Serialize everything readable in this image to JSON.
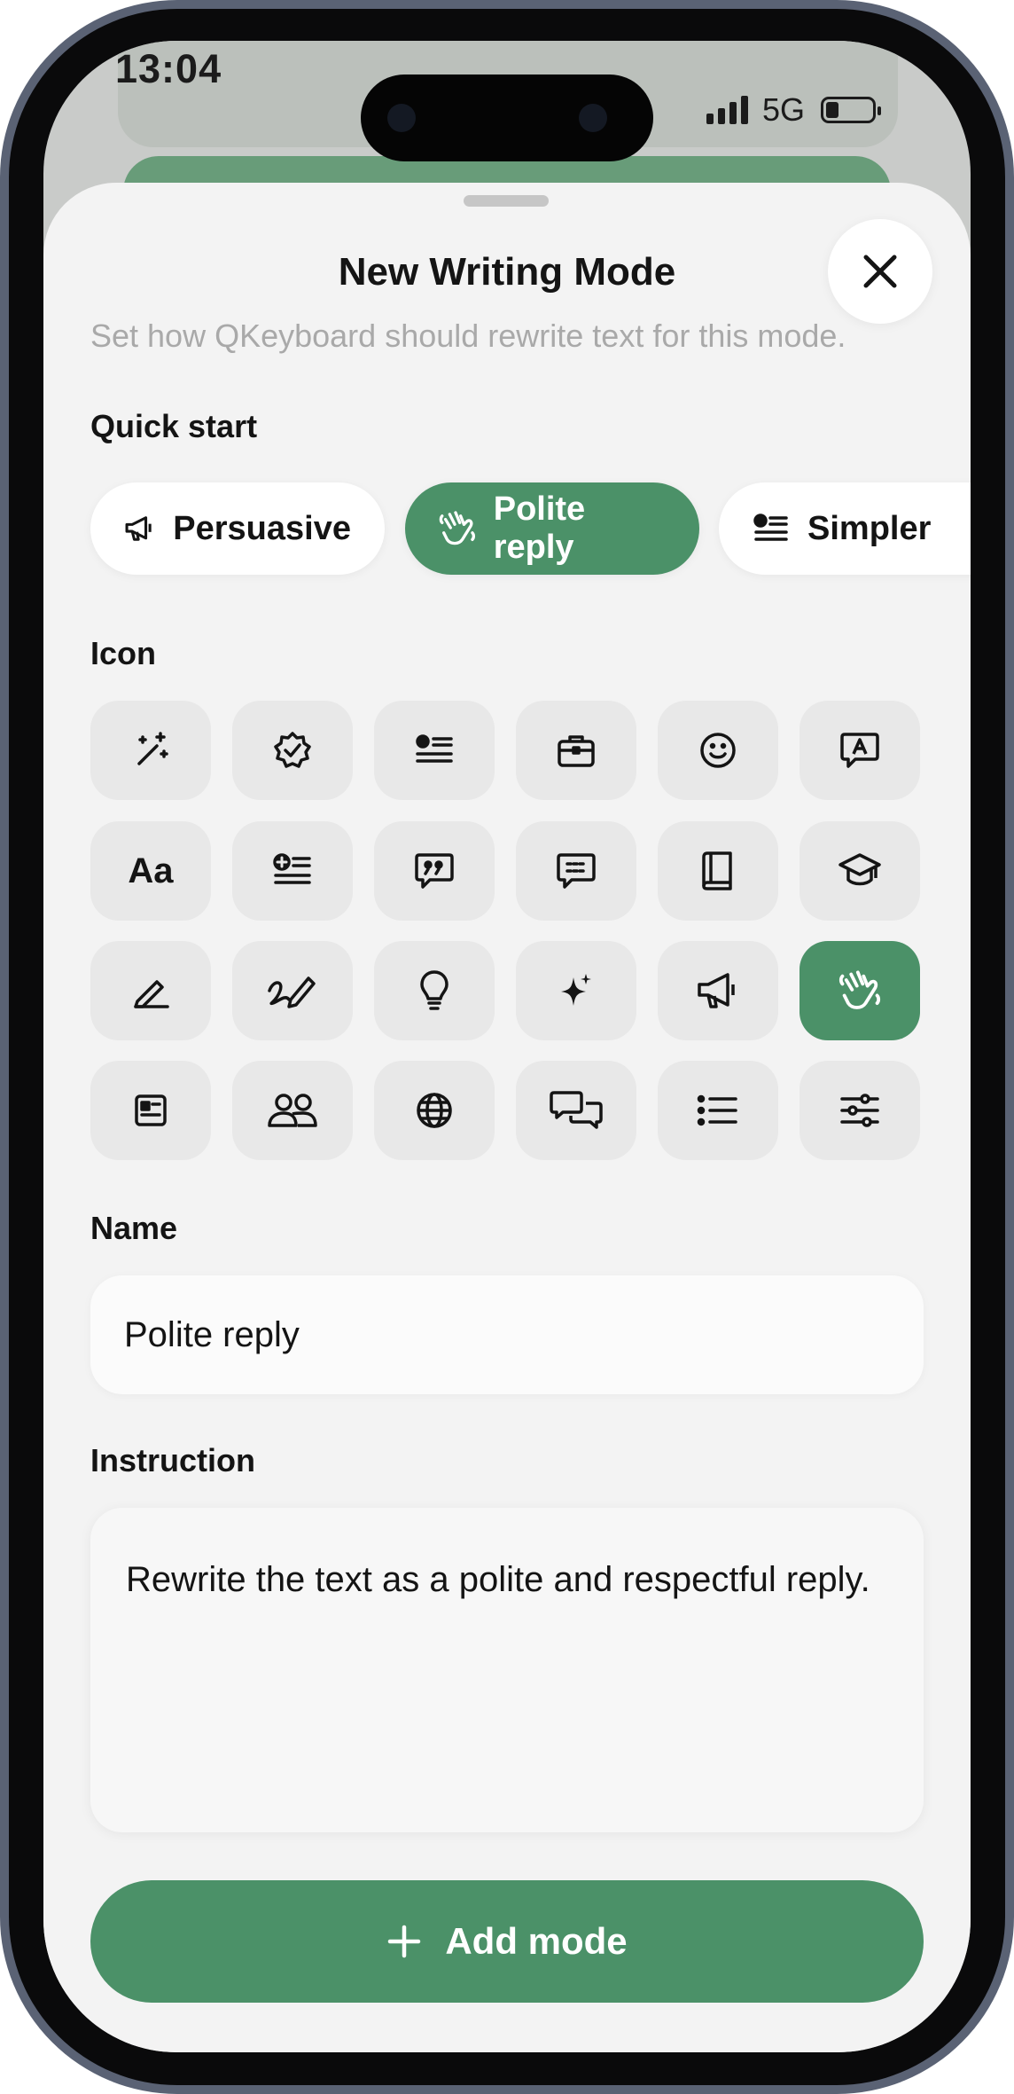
{
  "status_bar": {
    "time": "13:04",
    "network": "5G"
  },
  "sheet": {
    "title": "New Writing Mode",
    "subtitle": "Set how QKeyboard should rewrite text for this mode."
  },
  "quick_start": {
    "label": "Quick start",
    "chips": [
      {
        "label": "Persuasive",
        "icon": "megaphone-icon",
        "selected": false
      },
      {
        "label": "Polite reply",
        "icon": "waving-hand-icon",
        "selected": true
      },
      {
        "label": "Simpler",
        "icon": "text-lines-icon",
        "selected": false
      }
    ]
  },
  "icon_picker": {
    "label": "Icon",
    "icons": [
      "magic-wand-icon",
      "verified-badge-icon",
      "text-lines-icon",
      "briefcase-icon",
      "smiley-icon",
      "text-bubble-icon",
      "font-size-icon",
      "add-text-icon",
      "quote-bubble-icon",
      "message-bubble-icon",
      "book-icon",
      "graduation-cap-icon",
      "pencil-underline-icon",
      "signature-icon",
      "lightbulb-icon",
      "sparkle-icon",
      "megaphone-icon",
      "waving-hand-icon",
      "document-icon",
      "people-icon",
      "globe-icon",
      "chat-bubbles-icon",
      "list-icon",
      "sliders-icon"
    ],
    "selected": "waving-hand-icon",
    "font_tile_text": "Aa"
  },
  "name": {
    "label": "Name",
    "value": "Polite reply"
  },
  "instruction": {
    "label": "Instruction",
    "value": "Rewrite the text as a polite and respectful reply."
  },
  "add_button": {
    "label": "Add mode"
  },
  "colors": {
    "accent": "#4b9168",
    "sheet_bg": "#f3f3f3",
    "tile_bg": "#e8e8e8"
  }
}
